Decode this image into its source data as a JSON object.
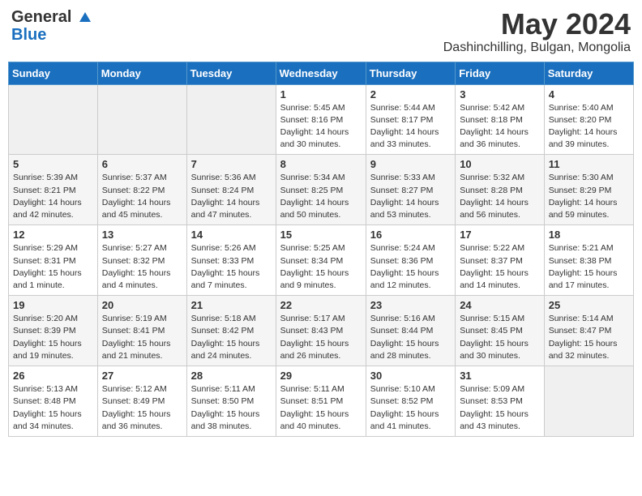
{
  "header": {
    "logo_general": "General",
    "logo_blue": "Blue",
    "title": "May 2024",
    "location": "Dashinchilling, Bulgan, Mongolia"
  },
  "days_of_week": [
    "Sunday",
    "Monday",
    "Tuesday",
    "Wednesday",
    "Thursday",
    "Friday",
    "Saturday"
  ],
  "weeks": [
    [
      {
        "day": "",
        "info": ""
      },
      {
        "day": "",
        "info": ""
      },
      {
        "day": "",
        "info": ""
      },
      {
        "day": "1",
        "info": "Sunrise: 5:45 AM\nSunset: 8:16 PM\nDaylight: 14 hours\nand 30 minutes."
      },
      {
        "day": "2",
        "info": "Sunrise: 5:44 AM\nSunset: 8:17 PM\nDaylight: 14 hours\nand 33 minutes."
      },
      {
        "day": "3",
        "info": "Sunrise: 5:42 AM\nSunset: 8:18 PM\nDaylight: 14 hours\nand 36 minutes."
      },
      {
        "day": "4",
        "info": "Sunrise: 5:40 AM\nSunset: 8:20 PM\nDaylight: 14 hours\nand 39 minutes."
      }
    ],
    [
      {
        "day": "5",
        "info": "Sunrise: 5:39 AM\nSunset: 8:21 PM\nDaylight: 14 hours\nand 42 minutes."
      },
      {
        "day": "6",
        "info": "Sunrise: 5:37 AM\nSunset: 8:22 PM\nDaylight: 14 hours\nand 45 minutes."
      },
      {
        "day": "7",
        "info": "Sunrise: 5:36 AM\nSunset: 8:24 PM\nDaylight: 14 hours\nand 47 minutes."
      },
      {
        "day": "8",
        "info": "Sunrise: 5:34 AM\nSunset: 8:25 PM\nDaylight: 14 hours\nand 50 minutes."
      },
      {
        "day": "9",
        "info": "Sunrise: 5:33 AM\nSunset: 8:27 PM\nDaylight: 14 hours\nand 53 minutes."
      },
      {
        "day": "10",
        "info": "Sunrise: 5:32 AM\nSunset: 8:28 PM\nDaylight: 14 hours\nand 56 minutes."
      },
      {
        "day": "11",
        "info": "Sunrise: 5:30 AM\nSunset: 8:29 PM\nDaylight: 14 hours\nand 59 minutes."
      }
    ],
    [
      {
        "day": "12",
        "info": "Sunrise: 5:29 AM\nSunset: 8:31 PM\nDaylight: 15 hours\nand 1 minute."
      },
      {
        "day": "13",
        "info": "Sunrise: 5:27 AM\nSunset: 8:32 PM\nDaylight: 15 hours\nand 4 minutes."
      },
      {
        "day": "14",
        "info": "Sunrise: 5:26 AM\nSunset: 8:33 PM\nDaylight: 15 hours\nand 7 minutes."
      },
      {
        "day": "15",
        "info": "Sunrise: 5:25 AM\nSunset: 8:34 PM\nDaylight: 15 hours\nand 9 minutes."
      },
      {
        "day": "16",
        "info": "Sunrise: 5:24 AM\nSunset: 8:36 PM\nDaylight: 15 hours\nand 12 minutes."
      },
      {
        "day": "17",
        "info": "Sunrise: 5:22 AM\nSunset: 8:37 PM\nDaylight: 15 hours\nand 14 minutes."
      },
      {
        "day": "18",
        "info": "Sunrise: 5:21 AM\nSunset: 8:38 PM\nDaylight: 15 hours\nand 17 minutes."
      }
    ],
    [
      {
        "day": "19",
        "info": "Sunrise: 5:20 AM\nSunset: 8:39 PM\nDaylight: 15 hours\nand 19 minutes."
      },
      {
        "day": "20",
        "info": "Sunrise: 5:19 AM\nSunset: 8:41 PM\nDaylight: 15 hours\nand 21 minutes."
      },
      {
        "day": "21",
        "info": "Sunrise: 5:18 AM\nSunset: 8:42 PM\nDaylight: 15 hours\nand 24 minutes."
      },
      {
        "day": "22",
        "info": "Sunrise: 5:17 AM\nSunset: 8:43 PM\nDaylight: 15 hours\nand 26 minutes."
      },
      {
        "day": "23",
        "info": "Sunrise: 5:16 AM\nSunset: 8:44 PM\nDaylight: 15 hours\nand 28 minutes."
      },
      {
        "day": "24",
        "info": "Sunrise: 5:15 AM\nSunset: 8:45 PM\nDaylight: 15 hours\nand 30 minutes."
      },
      {
        "day": "25",
        "info": "Sunrise: 5:14 AM\nSunset: 8:47 PM\nDaylight: 15 hours\nand 32 minutes."
      }
    ],
    [
      {
        "day": "26",
        "info": "Sunrise: 5:13 AM\nSunset: 8:48 PM\nDaylight: 15 hours\nand 34 minutes."
      },
      {
        "day": "27",
        "info": "Sunrise: 5:12 AM\nSunset: 8:49 PM\nDaylight: 15 hours\nand 36 minutes."
      },
      {
        "day": "28",
        "info": "Sunrise: 5:11 AM\nSunset: 8:50 PM\nDaylight: 15 hours\nand 38 minutes."
      },
      {
        "day": "29",
        "info": "Sunrise: 5:11 AM\nSunset: 8:51 PM\nDaylight: 15 hours\nand 40 minutes."
      },
      {
        "day": "30",
        "info": "Sunrise: 5:10 AM\nSunset: 8:52 PM\nDaylight: 15 hours\nand 41 minutes."
      },
      {
        "day": "31",
        "info": "Sunrise: 5:09 AM\nSunset: 8:53 PM\nDaylight: 15 hours\nand 43 minutes."
      },
      {
        "day": "",
        "info": ""
      }
    ]
  ]
}
